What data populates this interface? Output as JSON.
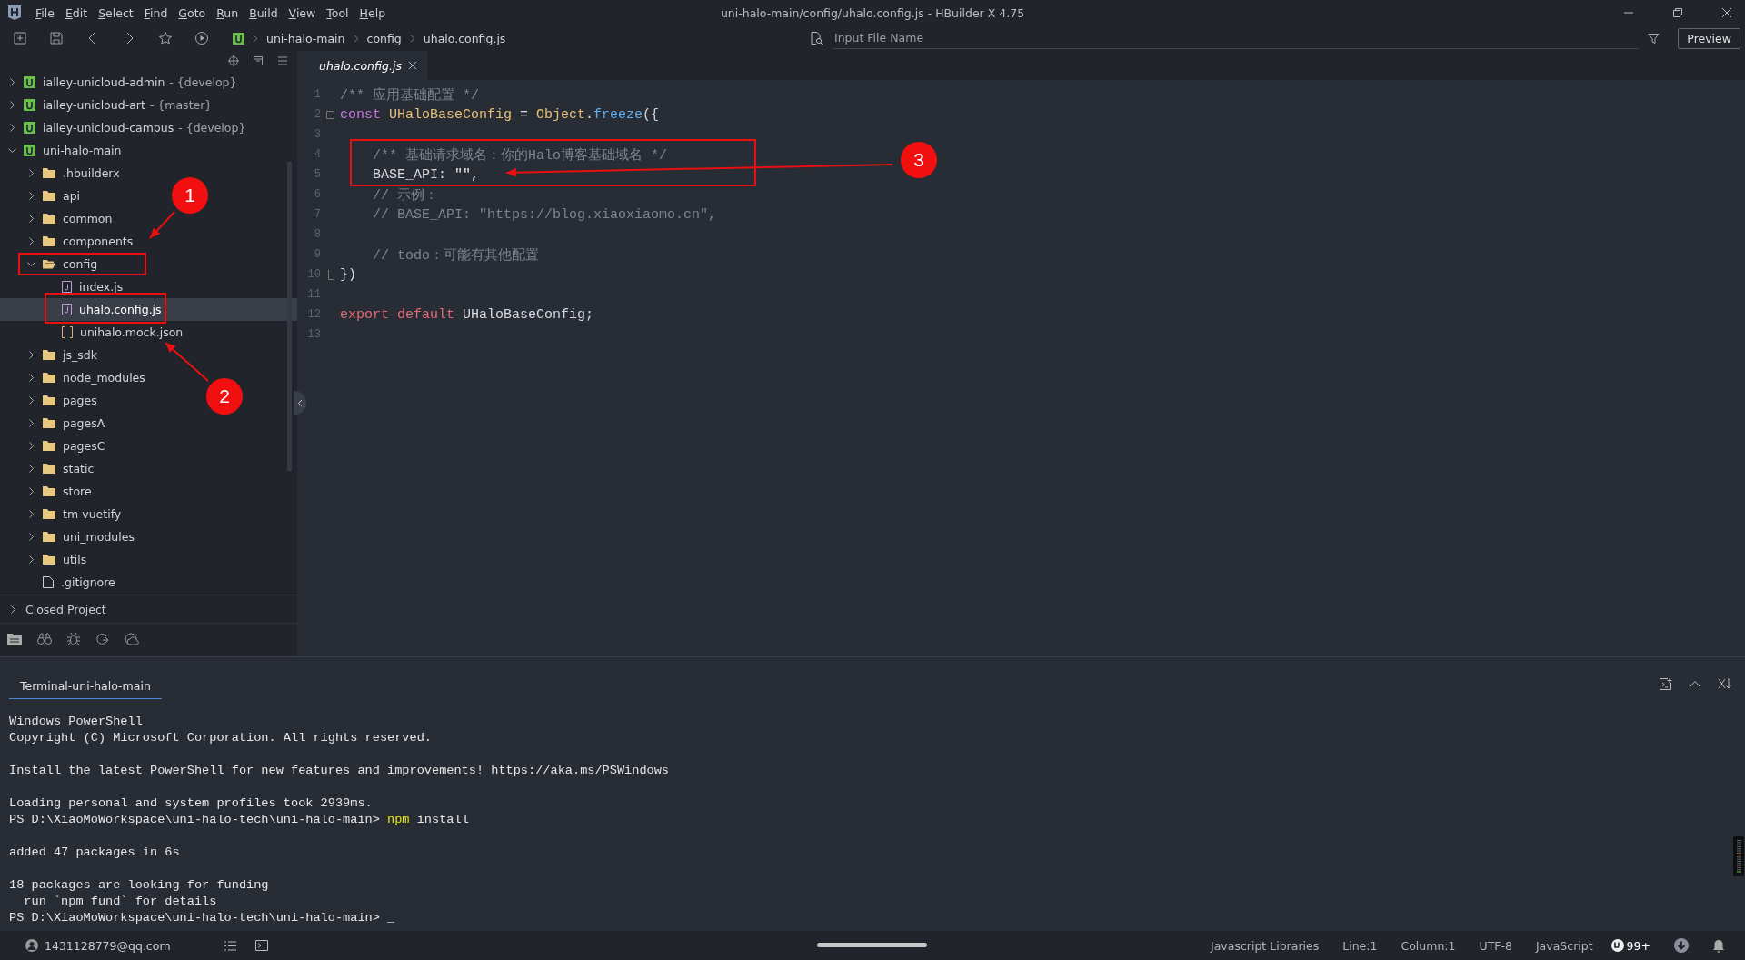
{
  "window": {
    "title": "uni-halo-main/config/uhalo.config.js - HBuilder X 4.75"
  },
  "menu": [
    "File",
    "Edit",
    "Select",
    "Find",
    "Goto",
    "Run",
    "Build",
    "View",
    "Tool",
    "Help"
  ],
  "toolbar": {
    "breadcrumb": [
      "uni-halo-main",
      "config",
      "uhalo.config.js"
    ],
    "search": {
      "placeholder": "Input File Name"
    },
    "preview_button": "Preview"
  },
  "sidebar": {
    "tree": [
      {
        "name": "ialley-unicloud-admin",
        "branch": "- {develop}",
        "kind": "project",
        "expanded": false,
        "selected": false
      },
      {
        "name": "ialley-unicloud-art",
        "branch": "- {master}",
        "kind": "project",
        "expanded": false,
        "selected": false
      },
      {
        "name": "ialley-unicloud-campus",
        "branch": "- {develop}",
        "kind": "project",
        "expanded": false,
        "selected": false
      },
      {
        "name": "uni-halo-main",
        "kind": "project",
        "expanded": true,
        "selected": false,
        "children": [
          {
            "name": ".hbuilderx",
            "kind": "folder",
            "expanded": false,
            "selected": false
          },
          {
            "name": "api",
            "kind": "folder",
            "expanded": false,
            "selected": false
          },
          {
            "name": "common",
            "kind": "folder",
            "expanded": false,
            "selected": false
          },
          {
            "name": "components",
            "kind": "folder",
            "expanded": false,
            "selected": false
          },
          {
            "name": "config",
            "kind": "folder",
            "expanded": true,
            "selected": false,
            "children": [
              {
                "name": "index.js",
                "kind": "js",
                "selected": false
              },
              {
                "name": "uhalo.config.js",
                "kind": "js",
                "selected": true
              },
              {
                "name": "unihalo.mock.json",
                "kind": "json",
                "selected": false
              }
            ]
          },
          {
            "name": "js_sdk",
            "kind": "folder",
            "expanded": false,
            "selected": false
          },
          {
            "name": "node_modules",
            "kind": "folder",
            "expanded": false,
            "selected": false
          },
          {
            "name": "pages",
            "kind": "folder",
            "expanded": false,
            "selected": false
          },
          {
            "name": "pagesA",
            "kind": "folder",
            "expanded": false,
            "selected": false
          },
          {
            "name": "pagesC",
            "kind": "folder",
            "expanded": false,
            "selected": false
          },
          {
            "name": "static",
            "kind": "folder",
            "expanded": false,
            "selected": false
          },
          {
            "name": "store",
            "kind": "folder",
            "expanded": false,
            "selected": false
          },
          {
            "name": "tm-vuetify",
            "kind": "folder",
            "expanded": false,
            "selected": false
          },
          {
            "name": "uni_modules",
            "kind": "folder",
            "expanded": false,
            "selected": false
          },
          {
            "name": "utils",
            "kind": "folder",
            "expanded": false,
            "selected": false
          },
          {
            "name": ".gitignore",
            "kind": "file",
            "selected": false
          }
        ]
      }
    ],
    "closed_project": {
      "label": "Closed Project",
      "expanded": false
    }
  },
  "editor": {
    "tabs": [
      {
        "label": "uhalo.config.js",
        "selected": true
      }
    ],
    "lines": [
      {
        "number": "1",
        "foldable": false,
        "fold_end": false,
        "tokens": [
          {
            "text": "/** 应用基础配置 */",
            "kind": "comment"
          }
        ]
      },
      {
        "number": "2",
        "foldable": true,
        "fold_end": false,
        "tokens": [
          {
            "text": "const",
            "kind": "keyword"
          },
          {
            "text": " UHaloBaseConfig",
            "kind": "type"
          },
          {
            "text": " = ",
            "kind": "plain"
          },
          {
            "text": "Object",
            "kind": "type"
          },
          {
            "text": ".",
            "kind": "plain"
          },
          {
            "text": "freeze",
            "kind": "func"
          },
          {
            "text": "({",
            "kind": "plain"
          }
        ]
      },
      {
        "number": "3",
        "foldable": false,
        "fold_end": false
      },
      {
        "number": "4",
        "foldable": false,
        "fold_end": false,
        "tokens": [
          {
            "text": "    /** 基础请求域名：你的Halo博客基础域名 */",
            "kind": "comment"
          }
        ]
      },
      {
        "number": "5",
        "foldable": false,
        "fold_end": false,
        "tokens": [
          {
            "text": "    BASE_API: ",
            "kind": "plain"
          },
          {
            "text": "\"\"",
            "kind": "string"
          },
          {
            "text": ",",
            "kind": "plain"
          }
        ]
      },
      {
        "number": "6",
        "foldable": false,
        "fold_end": false,
        "tokens": [
          {
            "text": "    // 示例：",
            "kind": "comment"
          }
        ]
      },
      {
        "number": "7",
        "foldable": false,
        "fold_end": false,
        "tokens": [
          {
            "text": "    // BASE_API: \"https://blog.xiaoxiaomo.cn\",",
            "kind": "comment"
          }
        ]
      },
      {
        "number": "8",
        "foldable": false,
        "fold_end": false
      },
      {
        "number": "9",
        "foldable": false,
        "fold_end": false,
        "tokens": [
          {
            "text": "    // todo：可能有其他配置",
            "kind": "comment"
          }
        ]
      },
      {
        "number": "10",
        "foldable": false,
        "fold_end": true,
        "tokens": [
          {
            "text": "})",
            "kind": "plain"
          }
        ]
      },
      {
        "number": "11",
        "foldable": false,
        "fold_end": false
      },
      {
        "number": "12",
        "foldable": false,
        "fold_end": false,
        "tokens": [
          {
            "text": "export",
            "kind": "storage"
          },
          {
            "text": " default",
            "kind": "storage"
          },
          {
            "text": " UHaloBaseConfig;",
            "kind": "plain"
          }
        ]
      },
      {
        "number": "13",
        "foldable": false,
        "fold_end": false
      }
    ]
  },
  "annotations": [
    {
      "number": "1"
    },
    {
      "number": "2"
    },
    {
      "number": "3"
    }
  ],
  "terminal": {
    "tabs": [
      {
        "label": "Terminal-uni-halo-main",
        "selected": true
      }
    ],
    "blocks": [
      [
        [
          {
            "text": "Windows PowerShell",
            "kind": "text"
          }
        ],
        [
          {
            "text": "Copyright (C) Microsoft Corporation. All rights reserved.",
            "kind": "text"
          }
        ]
      ],
      [
        [
          {
            "text": "Install the latest PowerShell for new features and improvements! https://aka.ms/PSWindows",
            "kind": "text"
          }
        ]
      ],
      [
        [
          {
            "text": "Loading personal and system profiles took 2939ms.",
            "kind": "text"
          }
        ],
        [
          {
            "text": "PS D:\\XiaoMoWorkspace\\uni-halo-tech\\uni-halo-main> ",
            "kind": "text"
          },
          {
            "text": "npm",
            "kind": "command"
          },
          {
            "text": " install",
            "kind": "text"
          }
        ]
      ],
      [
        [
          {
            "text": "added 47 packages in 6s",
            "kind": "text"
          }
        ]
      ],
      [
        [
          {
            "text": "18 packages are looking for funding",
            "kind": "text"
          }
        ],
        [
          {
            "text": "  run `npm fund` for details",
            "kind": "text"
          }
        ],
        [
          {
            "text": "PS D:\\XiaoMoWorkspace\\uni-halo-tech\\uni-halo-main> _",
            "kind": "text"
          }
        ]
      ]
    ]
  },
  "status_bar": {
    "user": "1431128779@qq.com",
    "items": [
      "Javascript Libraries",
      "Line:1",
      "Column:1",
      "UTF-8",
      "JavaScript"
    ],
    "notifications": "99+"
  }
}
